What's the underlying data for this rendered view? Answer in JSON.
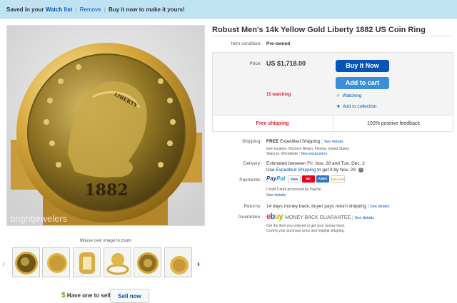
{
  "banner": {
    "saved_text": "Saved in your",
    "watchlist_link": "Watch list",
    "remove_link": "Remove",
    "buy_now_text": "Buy it now to make it yours!"
  },
  "gallery": {
    "watermark": "brightjewelers",
    "zoom_hint": "Mouse over image to zoom",
    "thumbnail_count": 6,
    "coin_year": "1882",
    "coin_word": "LIBERTY"
  },
  "sell": {
    "prompt": "Have one to sell?",
    "button": "Sell now"
  },
  "item": {
    "title": "Robust Men's 14k Yellow Gold Liberty 1882 US Coin Ring",
    "condition_label": "Item condition:",
    "condition_value": "Pre-owned",
    "price_label": "Price:",
    "price": "US $1,718.00",
    "buy_now": "Buy It Now",
    "add_to_cart": "Add to cart",
    "watching": "15 watching",
    "watching_link": "Watching",
    "add_collection": "Add to collection",
    "free_shipping": "Free shipping",
    "feedback": "100% positive feedback"
  },
  "shipping": {
    "label": "Shipping:",
    "free": "FREE",
    "method": "Expedited Shipping",
    "see_details": "See details",
    "location": "Item location: Boynton Beach, Florida, United States",
    "ships_to": "Ships to: Worldwide",
    "see_exclusions": "See exclusions"
  },
  "delivery": {
    "label": "Delivery:",
    "estimate": "Estimated between Fri. Nov. 28 and Tue. Dec. 2",
    "use_prefix": "Use",
    "use_link": "Expedited Shipping",
    "use_suffix": "to get it by Nov. 29"
  },
  "payments": {
    "label": "Payments:",
    "paypal_1": "Pay",
    "paypal_2": "Pal",
    "cards": [
      "VISA",
      "MC",
      "AMEX",
      "DISCOVER"
    ],
    "processed": "Credit Cards processed by PayPal",
    "see_details": "See details"
  },
  "returns": {
    "label": "Returns:",
    "text": "14 days money back, buyer pays return shipping",
    "see_details": "See details"
  },
  "guarantee": {
    "label": "Guarantee:",
    "mbg": "MONEY BACK GUARANTEE",
    "see_details": "See details",
    "line1": "Get the item you ordered or get your money back.",
    "line2": "Covers your purchase price and original shipping."
  },
  "colors": {
    "link": "#0654ba",
    "buy_button": "#0654ba",
    "cart_button": "#3a8fd5",
    "alert_red": "#dd1e31",
    "banner_bg": "#bfe3f3"
  }
}
